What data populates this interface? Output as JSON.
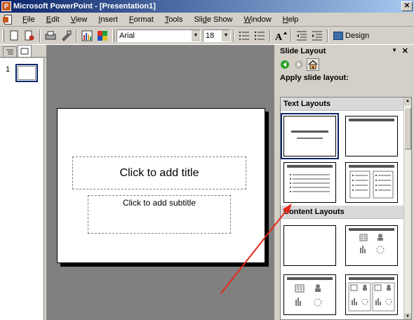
{
  "window": {
    "title": "Microsoft PowerPoint - [Presentation1]",
    "close_glyph": "✕"
  },
  "menu": {
    "items": [
      {
        "first": "F",
        "rest": "ile"
      },
      {
        "first": "E",
        "rest": "dit"
      },
      {
        "first": "V",
        "rest": "iew"
      },
      {
        "first": "I",
        "rest": "nsert"
      },
      {
        "first": "F",
        "rest": "ormat"
      },
      {
        "first": "T",
        "rest": "ools"
      },
      {
        "first": "",
        "pre": "Sli",
        "u": "d",
        "post": "e Show"
      },
      {
        "first": "W",
        "rest": "indow"
      },
      {
        "first": "H",
        "rest": "elp"
      }
    ]
  },
  "toolbar": {
    "font_name": "Arial",
    "font_size": "18",
    "design_label": "Design",
    "icons": [
      "new-icon",
      "open-icon",
      "print-icon",
      "format-painter-icon",
      "chart-icon",
      "color-icon"
    ]
  },
  "outline_pane": {
    "slide_number": "1"
  },
  "slide": {
    "title_placeholder": "Click to add title",
    "subtitle_placeholder": "Click to add subtitle"
  },
  "task_pane": {
    "title": "Slide Layout",
    "apply_label": "Apply slide layout:",
    "sections": [
      {
        "name": "Text Layouts"
      },
      {
        "name": "Content Layouts"
      }
    ]
  },
  "colors": {
    "titlebar_start": "#0a246a",
    "titlebar_end": "#a6caf0",
    "canvas_bg": "#808080",
    "annotation_arrow": "#e8281c"
  }
}
